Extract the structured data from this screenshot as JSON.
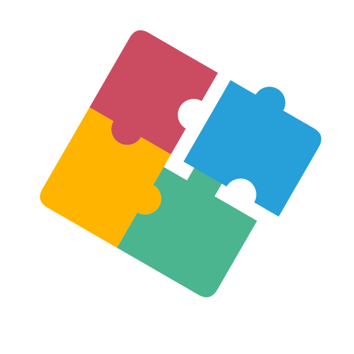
{
  "icon": {
    "name": "puzzle-pieces-icon",
    "pieces": [
      {
        "name": "red-puzzle-piece",
        "color": "#CB4C60"
      },
      {
        "name": "yellow-puzzle-piece",
        "color": "#FFB400"
      },
      {
        "name": "green-puzzle-piece",
        "color": "#4BB58F"
      },
      {
        "name": "blue-puzzle-piece",
        "color": "#279FD8"
      }
    ],
    "background": "#FFFFFF"
  }
}
